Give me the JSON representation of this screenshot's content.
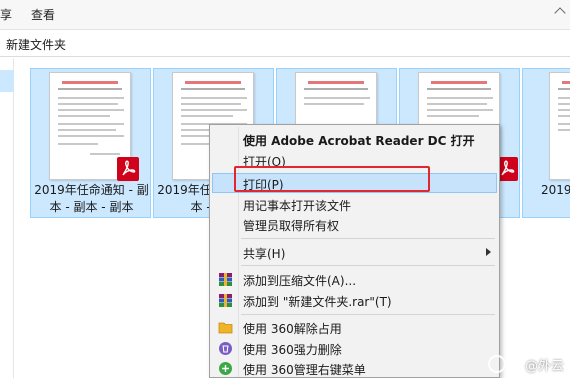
{
  "ribbon": {
    "tabs": [
      "享",
      "查看"
    ]
  },
  "address": {
    "path": "新建文件夹"
  },
  "files": [
    {
      "name": "2019年任命通知 - 副本 - 副本 - 副本",
      "selected": true
    },
    {
      "name": "2019年任命通知 - 副本 - 副本",
      "selected": true
    },
    {
      "name": "",
      "selected": true
    },
    {
      "name": "",
      "selected": true
    },
    {
      "name": "2019年",
      "selected": true
    }
  ],
  "context_menu": {
    "items": [
      {
        "label": "使用 Adobe Acrobat Reader DC 打开",
        "bold": true,
        "icon": "none"
      },
      {
        "label": "打开(O)",
        "icon": "none"
      },
      {
        "label": "打印(P)",
        "icon": "none",
        "hover": true
      },
      {
        "label": "用记事本打开该文件",
        "icon": "none"
      },
      {
        "label": "管理员取得所有权",
        "icon": "none"
      },
      {
        "label": "共享(H)",
        "icon": "none",
        "submenu": true
      },
      {
        "label": "添加到压缩文件(A)...",
        "icon": "winrar-icon"
      },
      {
        "label": "添加到 \"新建文件夹.rar\"(T)",
        "icon": "winrar-icon"
      },
      {
        "label": "使用 360解除占用",
        "icon": "360-unlock-icon"
      },
      {
        "label": "使用 360强力删除",
        "icon": "360-delete-icon"
      },
      {
        "label": "使用 360管理右键菜单",
        "icon": "360-menu-icon"
      }
    ]
  },
  "watermark": {
    "text": "@外云"
  },
  "colors": {
    "selection": "#cce8ff",
    "menu_hover": "#c7e3fb",
    "highlight": "#e0282e",
    "pdf_red": "#d0021b"
  }
}
